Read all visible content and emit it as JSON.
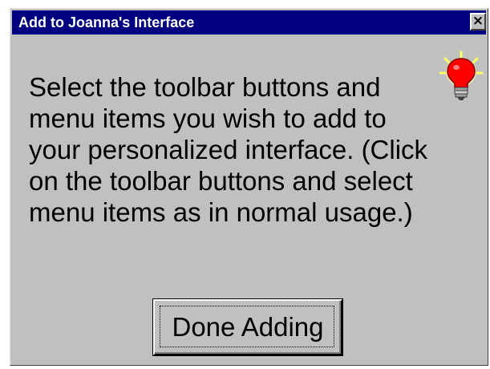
{
  "window": {
    "title": "Add to Joanna's Interface",
    "close_glyph": "×"
  },
  "message": {
    "lines": [
      "Select the toolbar buttons and",
      "menu items you wish to add to",
      "your personalized interface. (Click",
      "on the toolbar buttons and select",
      "menu items as in normal usage.)"
    ]
  },
  "icon": {
    "name": "lightbulb-icon",
    "bulb_color": "#ff0000",
    "glow_color": "#ffff66"
  },
  "done_button": {
    "label": "Done Adding"
  },
  "colors": {
    "titlebar": "#000080",
    "face": "#c0c0c0"
  }
}
